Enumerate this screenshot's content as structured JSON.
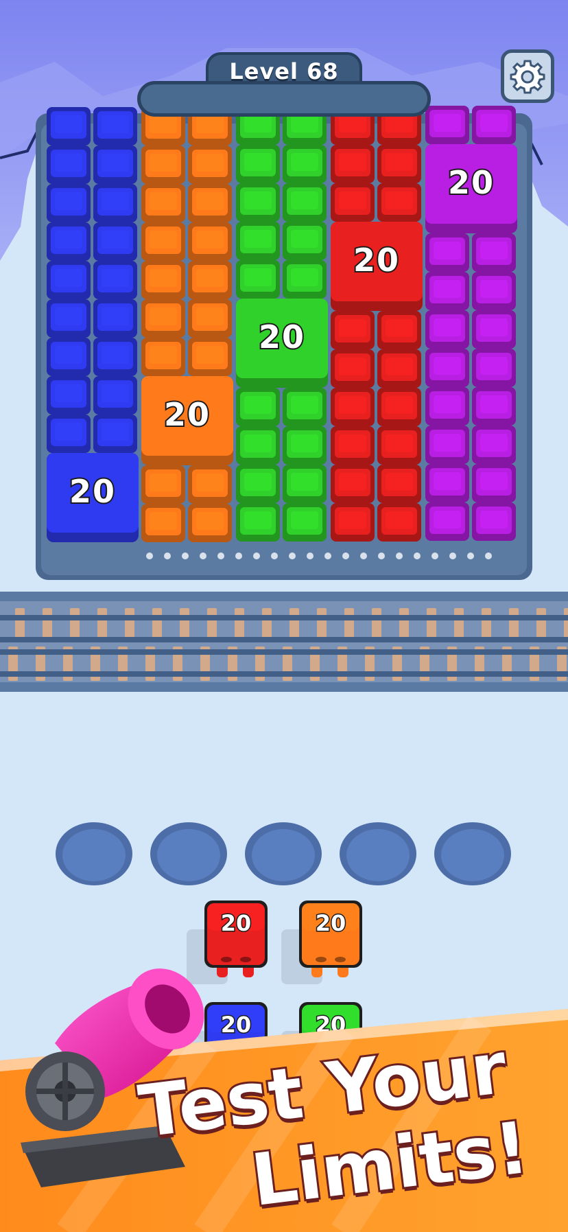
{
  "header": {
    "level_label": "Level 68",
    "progress_fraction": 0
  },
  "settings": {
    "icon": "gear-icon"
  },
  "colors": {
    "blue": "#2f3bf0",
    "orange": "#ff7a1a",
    "green": "#2fd12a",
    "red": "#e8201f",
    "purple": "#b81fe3",
    "cannon": "#ff2bb4",
    "banner": "#ff8a1f"
  },
  "board": {
    "column_colors": [
      "blue",
      "orange",
      "green",
      "red",
      "purple"
    ],
    "big_blocks": [
      {
        "column": 0,
        "label": "20"
      },
      {
        "column": 1,
        "label": "20"
      },
      {
        "column": 2,
        "label": "20"
      },
      {
        "column": 3,
        "label": "20"
      },
      {
        "column": 4,
        "label": "20"
      }
    ]
  },
  "queue": {
    "slots": 5,
    "characters": [
      {
        "color": "red",
        "label": "20"
      },
      {
        "color": "orange",
        "label": "20"
      },
      {
        "color": "blue",
        "label": "20"
      },
      {
        "color": "green",
        "label": "20"
      }
    ]
  },
  "banner": {
    "line1": "Test Your",
    "line2": "Limits!"
  }
}
